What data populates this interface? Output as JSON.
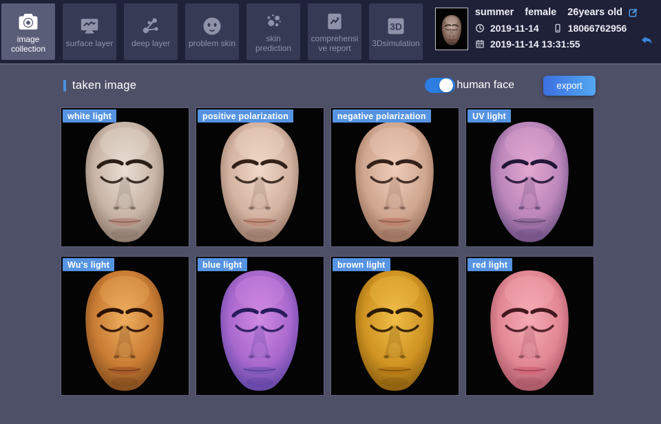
{
  "header": {
    "tabs": [
      {
        "label": "image collection",
        "icon": "camera-icon",
        "selected": true
      },
      {
        "label": "surface layer",
        "icon": "monitor-icon",
        "selected": false
      },
      {
        "label": "deep layer",
        "icon": "molecule-icon",
        "selected": false
      },
      {
        "label": "problem skin",
        "icon": "face-icon",
        "selected": false
      },
      {
        "label": "skin prediction",
        "icon": "bubbles-icon",
        "selected": false
      },
      {
        "label": "comprehensive report",
        "icon": "report-icon",
        "selected": false
      },
      {
        "label": "3Dsimulation",
        "icon": "3d-icon",
        "selected": false
      }
    ],
    "user": {
      "name": "summer",
      "gender": "female",
      "age": "26years old",
      "date": "2019-11-14",
      "phone": "18066762956",
      "datetime": "2019-11-14 13:31:55",
      "avatar_palette": [
        "#c9b2a4",
        "#86685c",
        "#2a201a",
        "#140e0a",
        "#6b463c"
      ]
    }
  },
  "main": {
    "section_title": "taken image",
    "toggle": {
      "label": "human face",
      "state": "on"
    },
    "export_label": "export",
    "images": [
      {
        "label": "white light",
        "palette": [
          "#e9ded2",
          "#c7b4a6",
          "#6b584c",
          "#2c1f16",
          "#b5887c"
        ]
      },
      {
        "label": "positive polarization",
        "palette": [
          "#f1d9c9",
          "#d3b2a0",
          "#77584a",
          "#32221a",
          "#c08a78"
        ]
      },
      {
        "label": "negative polarization",
        "palette": [
          "#eeccb9",
          "#d0a790",
          "#79523f",
          "#34211a",
          "#bd7f6c"
        ]
      },
      {
        "label": "UV light",
        "palette": [
          "#e3a8d0",
          "#bb86ba",
          "#473366",
          "#221636",
          "#8f6898"
        ]
      },
      {
        "label": "Wu's light",
        "palette": [
          "#eeae5e",
          "#c87c34",
          "#5c3212",
          "#2a1204",
          "#a55a28"
        ]
      },
      {
        "label": "blue light",
        "palette": [
          "#d18ae2",
          "#a868cc",
          "#3c3490",
          "#271c5c",
          "#7a58b8"
        ]
      },
      {
        "label": "brown light",
        "palette": [
          "#f0bd48",
          "#cf9322",
          "#664106",
          "#2a1a02",
          "#b27614"
        ]
      },
      {
        "label": "red light",
        "palette": [
          "#f6abb4",
          "#e18794",
          "#8a3c4c",
          "#44181f",
          "#d26678"
        ]
      }
    ]
  },
  "colors": {
    "accent": "#4a90e2",
    "chip_bg": "#5694e2",
    "toggle_bg": "#2b7de0",
    "export_grad_a": "#3d6fe0",
    "export_grad_b": "#52a8f2",
    "topbar_bg": "#1f2138",
    "tab_bg": "#363a54",
    "tab_selected_bg": "#5a5d78",
    "content_bg": "#4e5068",
    "panel_border": "#63657e",
    "info_icon": "#cdd0e0",
    "edit_icon": "#4a9be8",
    "back_icon": "#3a86e0"
  }
}
